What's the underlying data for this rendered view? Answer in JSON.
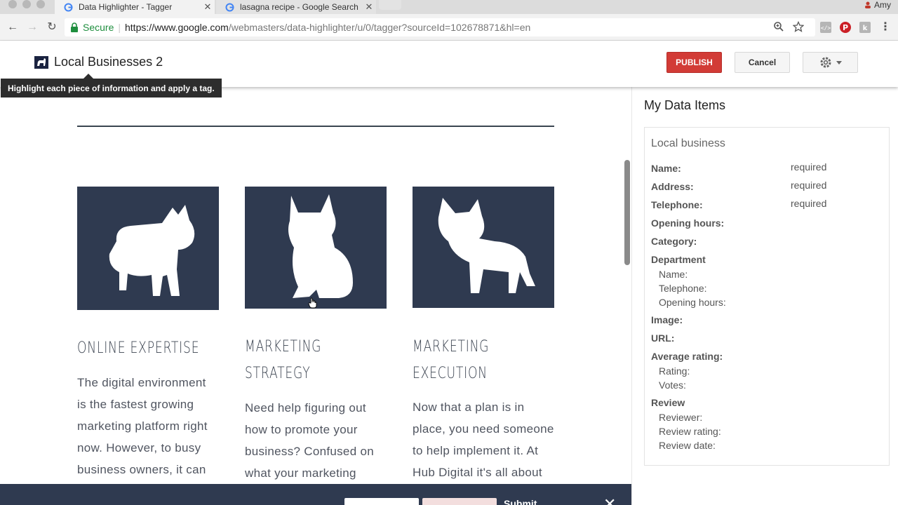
{
  "browser": {
    "tabs": [
      {
        "title": "Data Highlighter - Tagger",
        "active": true
      },
      {
        "title": "lasagna recipe - Google Search",
        "active": false
      }
    ],
    "profile": "Amy",
    "secure_label": "Secure",
    "url_host": "https://www.google.com",
    "url_path": "/webmasters/data-highlighter/u/0/tagger?sourceId=102678871&hl=en"
  },
  "header": {
    "title": "Local Businesses 2",
    "publish_label": "PUBLISH",
    "cancel_label": "Cancel",
    "tooltip": "Highlight each piece of information and apply a tag."
  },
  "cards": [
    {
      "title_line1": "ONLINE EXPERTISE",
      "title_line2": "",
      "body": [
        "The digital environment",
        "is the fastest growing",
        "marketing platform right",
        "now. However, to busy",
        "business owners, it can"
      ]
    },
    {
      "title_line1": "MARKETING",
      "title_line2": "STRATEGY",
      "body": [
        "Need help figuring out",
        "how to promote your",
        "business? Confused on",
        "what your marketing"
      ]
    },
    {
      "title_line1": "MARKETING",
      "title_line2": "EXECUTION",
      "body": [
        "Now that a plan is in",
        "place, you need someone",
        "to help implement it.  At",
        "Hub Digital it's all about"
      ]
    }
  ],
  "bottom_bar": {
    "submit_label": "Submit",
    "close_label": "✕"
  },
  "panel": {
    "title": "My Data Items",
    "box_title": "Local business",
    "required_text": "required",
    "fields": {
      "name": "Name:",
      "address": "Address:",
      "telephone": "Telephone:",
      "opening_hours": "Opening hours:",
      "category": "Category:",
      "department": "Department",
      "dept_name": "Name:",
      "dept_telephone": "Telephone:",
      "dept_opening_hours": "Opening hours:",
      "image": "Image:",
      "url": "URL:",
      "average_rating": "Average rating:",
      "rating": "Rating:",
      "votes": "Votes:",
      "review": "Review",
      "reviewer": "Reviewer:",
      "review_rating": "Review rating:",
      "review_date": "Review date:"
    }
  },
  "colors": {
    "publish": "#d23b36",
    "card_bg": "#2f3a50",
    "secure": "#1e8e3e"
  }
}
